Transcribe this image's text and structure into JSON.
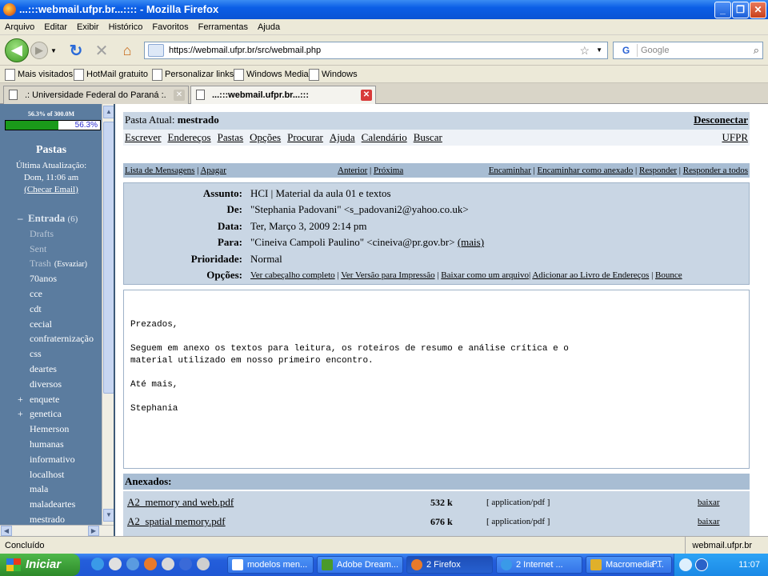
{
  "window": {
    "title": "...:::webmail.ufpr.br...:::: - Mozilla Firefox"
  },
  "menu": [
    "Arquivo",
    "Editar",
    "Exibir",
    "Histórico",
    "Favoritos",
    "Ferramentas",
    "Ajuda"
  ],
  "navbar": {
    "url": "https://webmail.ufpr.br/src/webmail.php",
    "search_placeholder": "Google"
  },
  "bookmarks": [
    "Mais visitados",
    "HotMail gratuito",
    "Personalizar links",
    "Windows Media",
    "Windows"
  ],
  "tabs": [
    {
      "label": ".: Universidade Federal do Paraná :."
    },
    {
      "label": "...:::webmail.ufpr.br...:::"
    }
  ],
  "sidebar": {
    "quota_label": "56.3% of 300.0M",
    "quota_pct_text": "56.3%",
    "quota_fraction": 0.563,
    "title": "Pastas",
    "update_label": "Última Atualização:",
    "update_time": "Dom, 11:06 am",
    "check_email": "(Checar Email)",
    "inbox": "Entrada",
    "inbox_count": "(6)",
    "empty_trash": "(Esvaziar)",
    "folders": [
      "Drafts",
      "Sent",
      "Trash",
      "70anos",
      "cce",
      "cdt",
      "cecial",
      "confraternização",
      "css",
      "deartes",
      "diversos",
      "enquete",
      "genetica",
      "Hemerson",
      "humanas",
      "informativo",
      "localhost",
      "mala",
      "maladeartes",
      "mestrado"
    ]
  },
  "main": {
    "current_folder_label": "Pasta Atual:",
    "current_folder": "mestrado",
    "disconnect": "Desconectar",
    "nav_links": [
      "Escrever",
      "Endereços",
      "Pastas",
      "Opções",
      "Procurar",
      "Ajuda",
      "Calendário",
      "Buscar"
    ],
    "ufpr": "UFPR",
    "msg_list": "Lista de Mensagens",
    "delete": "Apagar",
    "previous": "Anterior",
    "next": "Próxima",
    "forward": "Encaminhar",
    "forward_attach": "Encaminhar como anexado",
    "reply": "Responder",
    "reply_all": "Responder a todos"
  },
  "headers": {
    "subject_label": "Assunto:",
    "subject": "HCI | Material da aula 01 e textos",
    "from_label": "De:",
    "from": "\"Stephania Padovani\" <s_padovani2@yahoo.co.uk>",
    "date_label": "Data:",
    "date": "Ter, Março 3, 2009 2:14 pm",
    "to_label": "Para:",
    "to": "\"Cineiva Campoli Paulino\" <cineiva@pr.gov.br>",
    "more": "(mais)",
    "priority_label": "Prioridade:",
    "priority": "Normal",
    "options_label": "Opções:",
    "options": [
      "Ver cabeçalho completo",
      "Ver Versão para Impressão",
      "Baixar como um arquivo",
      "Adicionar ao Livro de Endereços",
      "Bounce"
    ]
  },
  "body": [
    "Prezados,",
    "Seguem em anexo os textos para leitura, os roteiros de resumo e análise crítica e o\nmaterial utilizado em nosso primeiro encontro.",
    "Até mais,",
    "Stephania"
  ],
  "attachments": {
    "label": "Anexados:",
    "items": [
      {
        "name": "A2_memory and web.pdf",
        "size": "532 k",
        "type": "[ application/pdf ]",
        "action": "baixar"
      },
      {
        "name": "A2_spatial memory.pdf",
        "size": "676 k",
        "type": "[ application/pdf ]",
        "action": "baixar"
      }
    ]
  },
  "status": {
    "text": "Concluído",
    "server": "webmail.ufpr.br"
  },
  "taskbar": {
    "start": "Iniciar",
    "tasks": [
      "modelos men...",
      "Adobe Dream...",
      "2 Firefox",
      "2 Internet ...",
      "Macromedia ..."
    ],
    "lang": "PT",
    "clock": "11:07"
  }
}
